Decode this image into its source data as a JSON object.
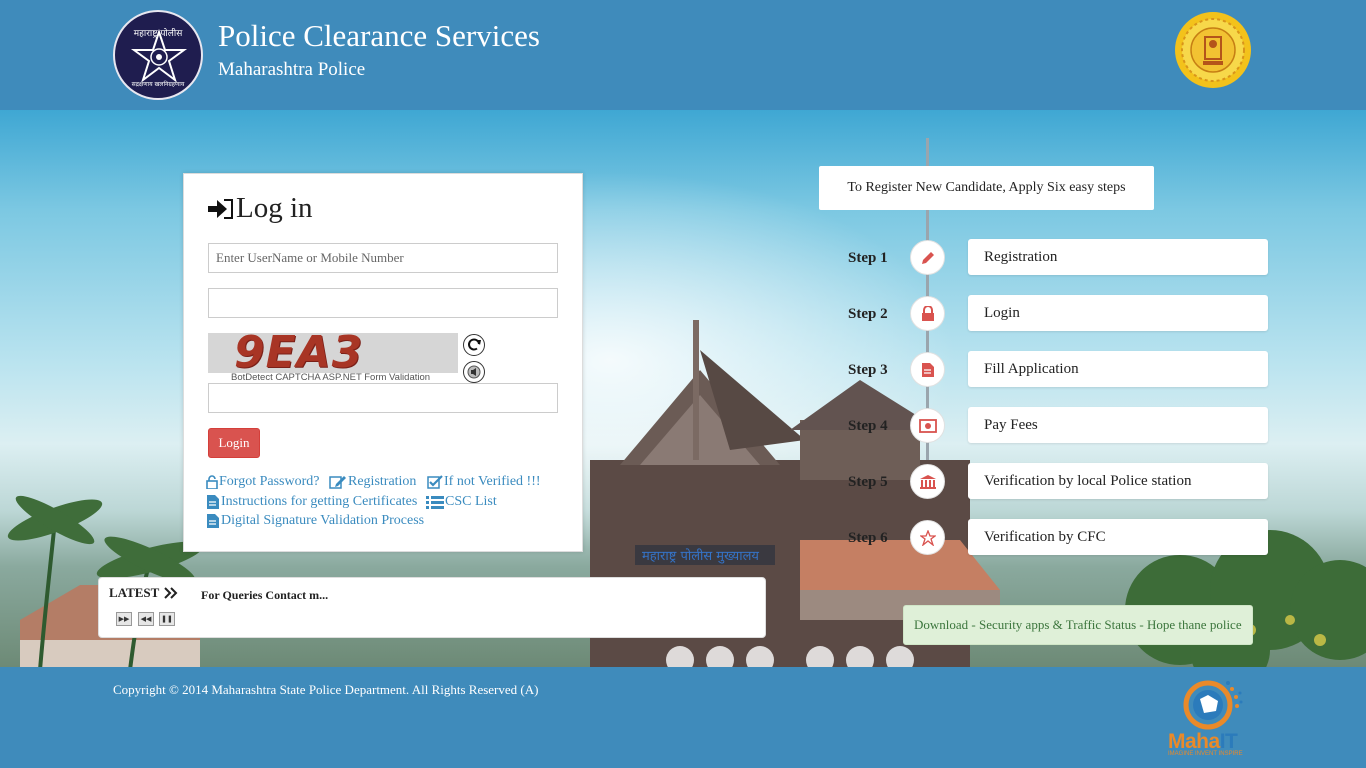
{
  "header": {
    "title": "Police Clearance Services",
    "subtitle": "Maharashtra Police",
    "logo_top_text": "महाराष्ट्र पोलीस",
    "logo_bottom_text": "सद्रक्षणाय खलनिग्रहणाय"
  },
  "login": {
    "heading": "Log in",
    "username_placeholder": "Enter UserName or Mobile Number",
    "password_value": "",
    "captcha_code": "9EA3",
    "captcha_caption": "BotDetect CAPTCHA ASP.NET Form Validation",
    "captcha_input_value": "",
    "login_button": "Login",
    "links": {
      "forgot": "Forgot Password?",
      "registration": "Registration",
      "not_verified": "If not Verified !!!",
      "instructions": "Instructions for getting Certificates",
      "csc": "CSC List",
      "digital_signature": "Digital Signature Validation Process"
    }
  },
  "latest": {
    "label": "LATEST",
    "text": "For Queries Contact m..."
  },
  "steps": {
    "title": "To Register New Candidate, Apply Six easy steps",
    "items": [
      {
        "label": "Step 1",
        "name": "Registration",
        "icon": "pencil-icon"
      },
      {
        "label": "Step 2",
        "name": "Login",
        "icon": "lock-icon"
      },
      {
        "label": "Step 3",
        "name": "Fill Application",
        "icon": "document-icon"
      },
      {
        "label": "Step 4",
        "name": "Pay Fees",
        "icon": "money-icon"
      },
      {
        "label": "Step 5",
        "name": "Verification by local Police station",
        "icon": "bank-icon"
      },
      {
        "label": "Step 6",
        "name": "Verification by CFC",
        "icon": "star-icon"
      }
    ]
  },
  "download": "Download - Security apps & Traffic Status - Hope thane police",
  "footer": {
    "copyright": "Copyright © 2014 Maharashtra State Police Department. All Rights Reserved (A)",
    "mahait_name_1": "Maha",
    "mahait_name_2": "IT",
    "mahait_tagline": "IMAGINE INVENT INSPIRE"
  },
  "colors": {
    "brand_blue": "#3f8bbb",
    "login_red": "#d9534f",
    "step_icon_red": "#d9534f",
    "link_blue": "#3a8bbf"
  }
}
